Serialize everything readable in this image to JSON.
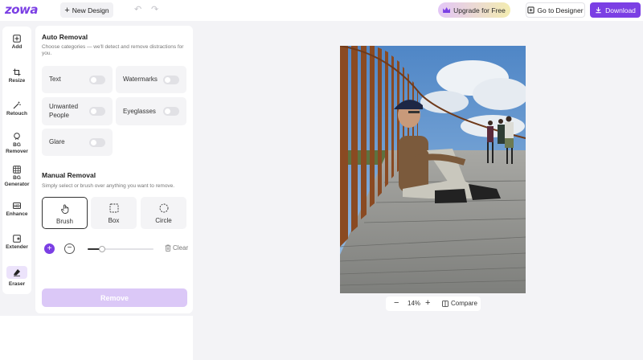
{
  "app": {
    "logo_text": "zowa",
    "accent": "#7b3fe4"
  },
  "toolbar": {
    "new_design_label": "New Design",
    "upgrade_label": "Upgrade for Free",
    "designer_label": "Go to Designer",
    "download_label": "Download"
  },
  "rail": {
    "items": [
      {
        "label": "Add",
        "icon": "plus-square-icon"
      },
      {
        "label": "Resize",
        "icon": "crop-icon"
      },
      {
        "label": "Retouch",
        "icon": "magic-wand-icon"
      },
      {
        "label": "BG Remover",
        "icon": "bg-remover-icon"
      },
      {
        "label": "BG Generator",
        "icon": "bg-generator-icon"
      },
      {
        "label": "Enhance",
        "icon": "hd-icon"
      },
      {
        "label": "Extender",
        "icon": "expand-icon"
      },
      {
        "label": "Eraser",
        "icon": "eraser-icon",
        "active": true
      }
    ]
  },
  "panel": {
    "auto_title": "Auto Removal",
    "auto_desc": "Choose categories — we'll detect and remove distractions for you.",
    "toggles": [
      {
        "label": "Text",
        "on": false
      },
      {
        "label": "Watermarks",
        "on": false
      },
      {
        "label": "Unwanted People",
        "on": false
      },
      {
        "label": "Eyeglasses",
        "on": false
      },
      {
        "label": "Glare",
        "on": false
      }
    ],
    "manual_title": "Manual Removal",
    "manual_desc": "Simply select or brush over anything you want to remove.",
    "modes": [
      {
        "label": "Brush",
        "active": true
      },
      {
        "label": "Box",
        "active": false
      },
      {
        "label": "Circle",
        "active": false
      }
    ],
    "brush_size_fraction": 0.22,
    "clear_label": "Clear",
    "remove_label": "Remove"
  },
  "canvas": {
    "zoom_label": "14%",
    "compare_label": "Compare"
  }
}
